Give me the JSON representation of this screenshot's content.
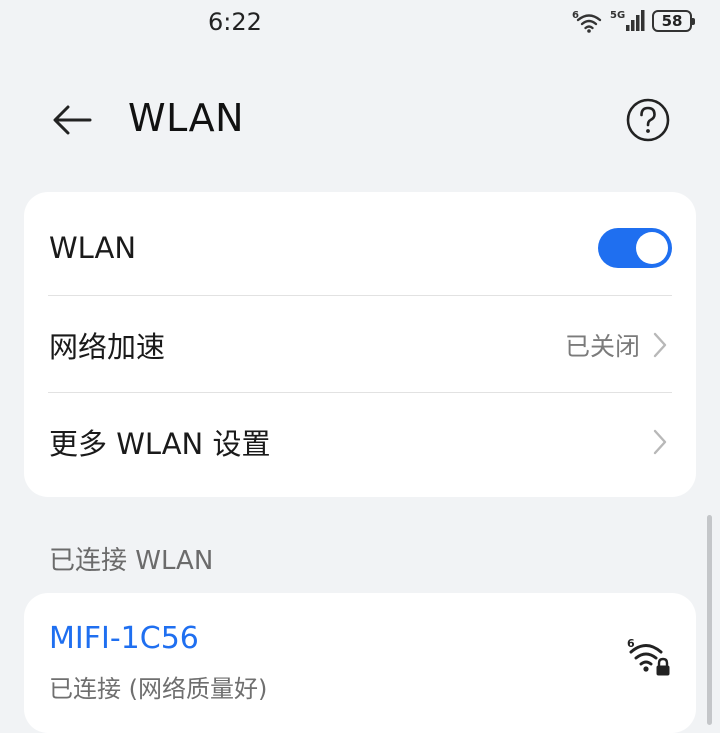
{
  "status_bar": {
    "time": "6:22",
    "wifi_icon_label": "6",
    "network_label": "5G",
    "battery_level": "58"
  },
  "header": {
    "title": "WLAN",
    "back_icon": "back-arrow-icon",
    "help_icon": "help-circle-icon"
  },
  "settings": {
    "wlan_label": "WLAN",
    "wlan_enabled": true,
    "accel_label": "网络加速",
    "accel_value": "已关闭",
    "more_label": "更多 WLAN 设置"
  },
  "connected_section": {
    "header": "已连接 WLAN",
    "network": {
      "name": "MIFI-1C56",
      "status": "已连接 (网络质量好)",
      "wifi_gen": "6",
      "secured": true
    }
  },
  "colors": {
    "accent": "#1f6ff0",
    "background": "#f1f3f5",
    "card": "#ffffff"
  }
}
